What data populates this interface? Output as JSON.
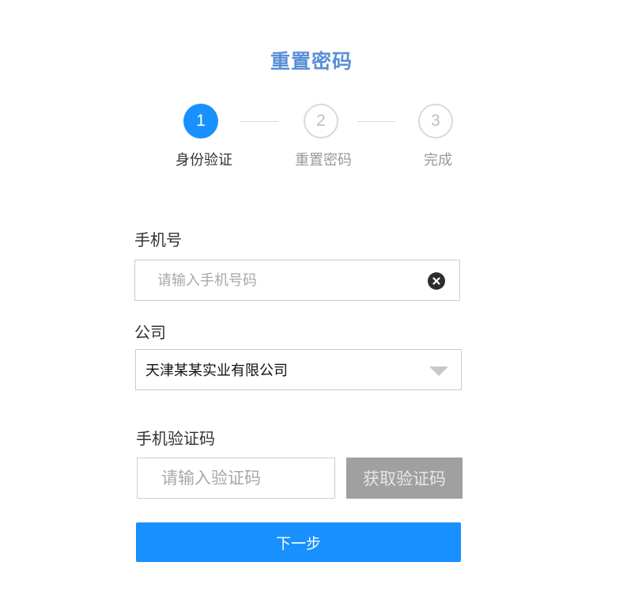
{
  "page": {
    "title": "重置密码"
  },
  "steps": [
    {
      "number": "1",
      "label": "身份验证",
      "state": "active"
    },
    {
      "number": "2",
      "label": "重置密码",
      "state": "inactive"
    },
    {
      "number": "3",
      "label": "完成",
      "state": "inactive"
    }
  ],
  "form": {
    "phone": {
      "label": "手机号",
      "placeholder": "请输入手机号码",
      "value": "",
      "clear_icon": "close-circle-icon"
    },
    "company": {
      "label": "公司",
      "selected": "天津某某实业有限公司",
      "caret_icon": "triangle-down-icon"
    },
    "code": {
      "label": "手机验证码",
      "placeholder": "请输入验证码",
      "value": "",
      "button_label": "获取验证码"
    },
    "submit_label": "下一步"
  },
  "colors": {
    "primary": "#1890ff",
    "title": "#5a8fd8",
    "disabled_button": "#a0a0a0"
  }
}
